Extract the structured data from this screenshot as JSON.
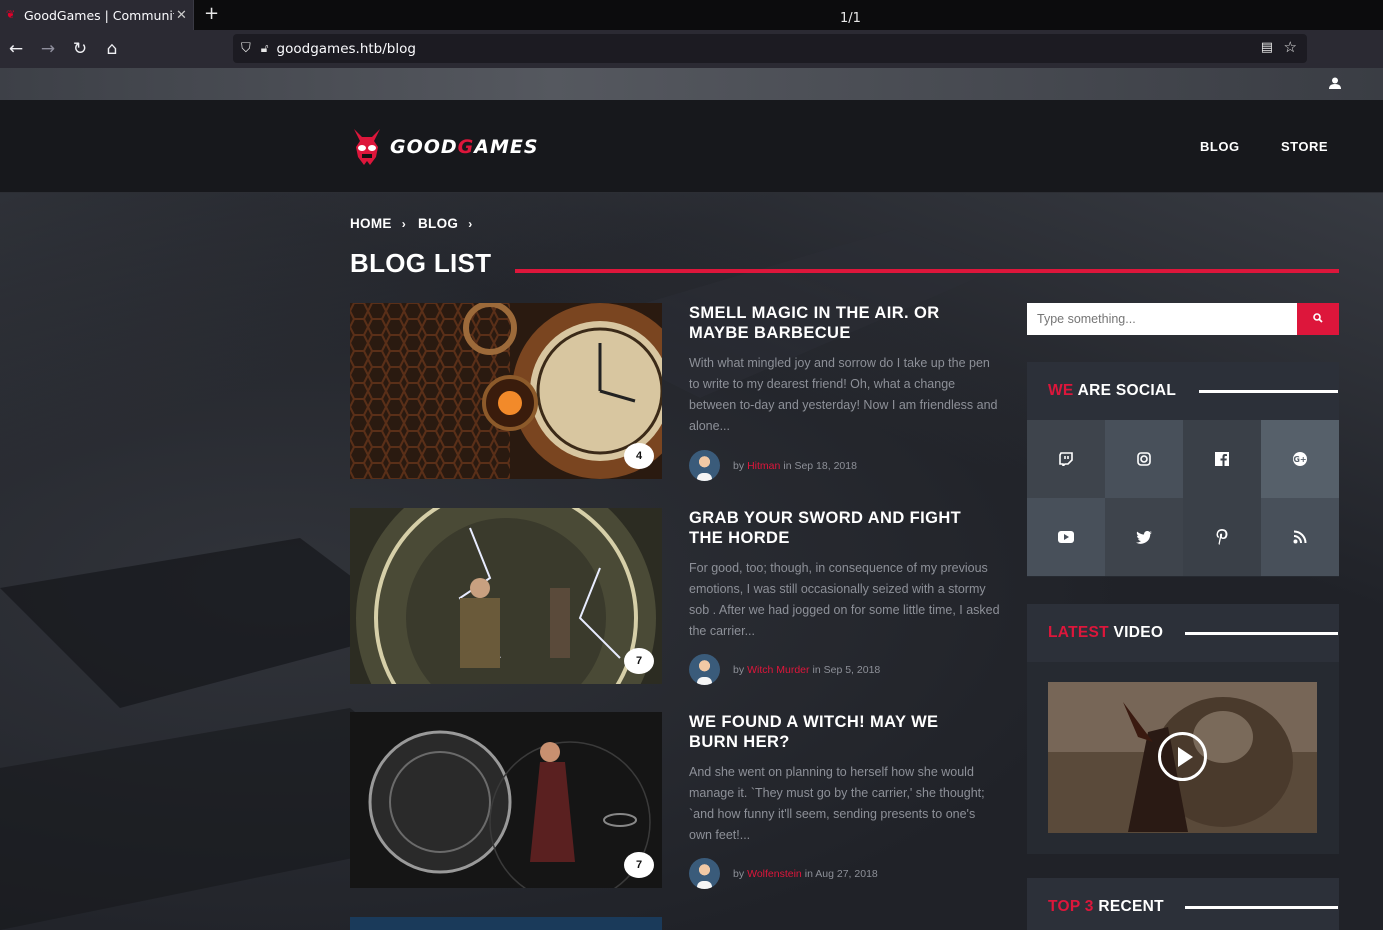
{
  "browser": {
    "tab_title": "GoodGames | Community",
    "tab_count": "1/1",
    "url": "goodgames.htb/blog"
  },
  "site": {
    "logo_part1": "GOOD",
    "logo_g": "G",
    "logo_part2": "AMES",
    "nav": [
      "BLOG",
      "STORE"
    ]
  },
  "breadcrumb": [
    "HOME",
    "BLOG"
  ],
  "page_title": "BLOG LIST",
  "posts": [
    {
      "title": "SMELL MAGIC IN THE AIR. OR MAYBE BARBECUE",
      "excerpt": "With what mingled joy and sorrow do I take up the pen to write to my dearest friend! Oh, what a change between to-day and yesterday! Now I am friendless and alone...",
      "comments": "4",
      "by": "by",
      "author": "Hitman",
      "date": "in Sep 18, 2018"
    },
    {
      "title": "GRAB YOUR SWORD AND FIGHT THE HORDE",
      "excerpt": "For good, too; though, in consequence of my previous emotions, I was still occasionally seized with a stormy sob . After we had jogged on for some little time, I asked the carrier...",
      "comments": "7",
      "by": "by",
      "author": "Witch Murder",
      "date": "in Sep 5, 2018"
    },
    {
      "title": "WE FOUND A WITCH! MAY WE BURN HER?",
      "excerpt": "And she went on planning to herself how she would manage it. `They must go by the carrier,' she thought; `and how funny it'll seem, sending presents to one's own feet!...",
      "comments": "7",
      "by": "by",
      "author": "Wolfenstein",
      "date": "in Aug 27, 2018"
    }
  ],
  "sidebar": {
    "search_placeholder": "Type something...",
    "social": {
      "title_red": "WE",
      "title_rest": " ARE SOCIAL",
      "icons": [
        "twitch-icon",
        "instagram-icon",
        "facebook-icon",
        "google-plus-icon",
        "youtube-icon",
        "twitter-icon",
        "pinterest-icon",
        "rss-icon"
      ]
    },
    "video": {
      "title_red": "LATEST",
      "title_rest": " VIDEO"
    },
    "recent": {
      "title_red": "TOP 3",
      "title_rest": " RECENT"
    }
  },
  "colors": {
    "accent": "#dd163b",
    "bg": "#202228"
  }
}
